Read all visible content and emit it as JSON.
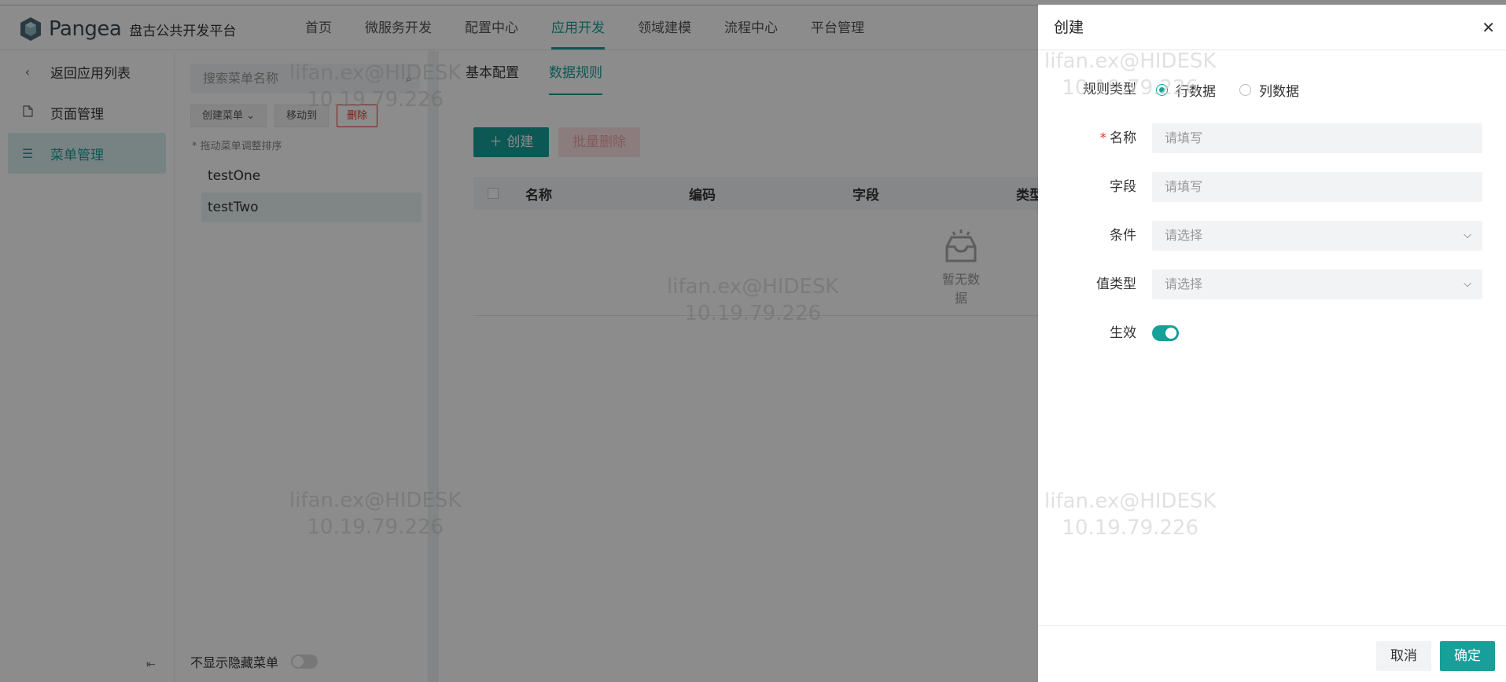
{
  "header": {
    "brand": "Pangea",
    "platform": "盘古公共开发平台",
    "nav": [
      "首页",
      "微服务开发",
      "配置中心",
      "应用开发",
      "领域建模",
      "流程中心",
      "平台管理"
    ],
    "active_nav": "应用开发"
  },
  "sidebar": {
    "items": [
      {
        "label": "返回应用列表",
        "icon": "chevron-left-icon"
      },
      {
        "label": "页面管理",
        "icon": "file-icon"
      },
      {
        "label": "菜单管理",
        "icon": "list-icon"
      }
    ],
    "active": "菜单管理"
  },
  "menu_panel": {
    "search_placeholder": "搜索菜单名称",
    "create_menu": "创建菜单",
    "move_to": "移动到",
    "delete": "删除",
    "drag_hint": "* 拖动菜单调整排序",
    "items": [
      "testOne",
      "testTwo"
    ],
    "selected": "testTwo",
    "hide_toggle_label": "不显示隐藏菜单"
  },
  "content": {
    "tabs": [
      "基本配置",
      "数据规则"
    ],
    "active_tab": "数据规则",
    "create_button": "创建",
    "bulk_delete_button": "批量删除",
    "columns": [
      "名称",
      "编码",
      "字段",
      "类型"
    ],
    "empty_text": "暂无数据"
  },
  "watermark": {
    "user": "lifan.ex@HIDESK",
    "ip": "10.19.79.226"
  },
  "drawer": {
    "title": "创建",
    "rule_type_label": "规则类型",
    "rule_type_options": [
      "行数据",
      "列数据"
    ],
    "rule_type_selected": "行数据",
    "name_label": "名称",
    "name_placeholder": "请填写",
    "field_label": "字段",
    "field_placeholder": "请填写",
    "condition_label": "条件",
    "condition_placeholder": "请选择",
    "value_type_label": "值类型",
    "value_type_placeholder": "请选择",
    "enabled_label": "生效",
    "enabled": true,
    "cancel": "取消",
    "confirm": "确定"
  },
  "colors": {
    "accent": "#16a099",
    "danger": "#e33333"
  }
}
